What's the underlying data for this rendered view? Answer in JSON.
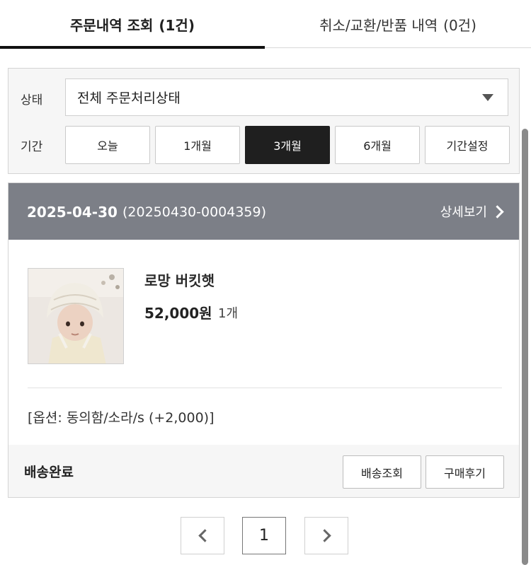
{
  "tabs": {
    "orders": {
      "label": "주문내역 조회",
      "count": "(1건)"
    },
    "returns": {
      "label": "취소/교환/반품 내역",
      "count": "(0건)"
    }
  },
  "filter": {
    "status_label": "상태",
    "status_value": "전체 주문처리상태",
    "period_label": "기간",
    "period_options": [
      "오늘",
      "1개월",
      "3개월",
      "6개월",
      "기간설정"
    ],
    "period_selected": "3개월"
  },
  "order": {
    "date": "2025-04-30",
    "order_no": "(20250430-0004359)",
    "detail_label": "상세보기",
    "product": {
      "name": "로망 버킷햇",
      "price": "52,000원",
      "quantity": "1개",
      "option": "[옵션: 동의함/소라/s (+2,000)]"
    },
    "shipping_status": "배송완료",
    "track_label": "배송조회",
    "review_label": "구매후기"
  },
  "pagination": {
    "current": "1"
  }
}
